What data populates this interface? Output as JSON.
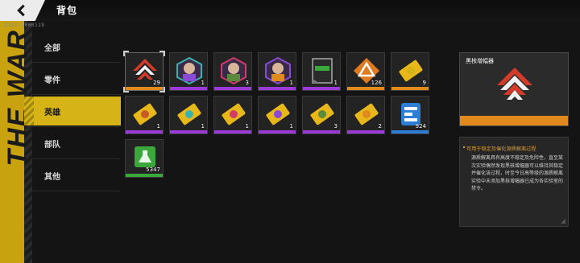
{
  "header": {
    "title": "背包",
    "uid": "UID2:1000119"
  },
  "deco_text": "THE WAR",
  "nav": {
    "items": [
      {
        "label": "全部",
        "active": false
      },
      {
        "label": "零件",
        "active": false
      },
      {
        "label": "英雄",
        "active": true
      },
      {
        "label": "部队",
        "active": false
      },
      {
        "label": "其他",
        "active": false
      }
    ]
  },
  "inventory": {
    "items": [
      {
        "icon": "upgrade-chevron-icon",
        "qty": "29",
        "rarity": "#e08a1e",
        "selected": true
      },
      {
        "icon": "hero-portrait-icon",
        "qty": "1",
        "rarity": "#9b3ad6"
      },
      {
        "icon": "hero-portrait-icon",
        "qty": "3",
        "rarity": "#9b3ad6"
      },
      {
        "icon": "hero-portrait-icon",
        "qty": "1",
        "rarity": "#9b3ad6"
      },
      {
        "icon": "weapon-card-icon",
        "qty": "1",
        "rarity": "#9b3ad6"
      },
      {
        "icon": "triangle-core-icon",
        "qty": "126",
        "rarity": "#e08a1e"
      },
      {
        "icon": "gold-ticket-icon",
        "qty": "9",
        "rarity": "#e08a1e"
      },
      {
        "icon": "gold-ticket-icon",
        "qty": "1",
        "rarity": "#9b3ad6"
      },
      {
        "icon": "gold-ticket-icon",
        "qty": "1",
        "rarity": "#9b3ad6"
      },
      {
        "icon": "gold-ticket-icon",
        "qty": "1",
        "rarity": "#9b3ad6"
      },
      {
        "icon": "gold-ticket-icon",
        "qty": "1",
        "rarity": "#9b3ad6"
      },
      {
        "icon": "gold-ticket-icon",
        "qty": "3",
        "rarity": "#9b3ad6"
      },
      {
        "icon": "gold-ticket-icon",
        "qty": "2",
        "rarity": "#9b3ad6"
      },
      {
        "icon": "blue-chip-icon",
        "qty": "924",
        "rarity": "#2d7fd6"
      },
      {
        "icon": "green-flask-icon",
        "qty": "5347",
        "rarity": "#3aa83a"
      }
    ]
  },
  "detail": {
    "name": "黑核增幅器",
    "headline": "可用于稳定及催化源质解离过程",
    "body": "源质解离具有高度不稳定及危险性，直至某次实验偶然发现黑核增幅器可以维持其稳定并催化该过程，时至今日高等级的源质解离实验中未添加黑核增幅器已成为各实验室的禁令。"
  },
  "colors": {
    "accent": "#d6b417",
    "orange": "#e08a1e",
    "purple": "#9b3ad6",
    "blue": "#2d7fd6",
    "green": "#3aa83a"
  }
}
